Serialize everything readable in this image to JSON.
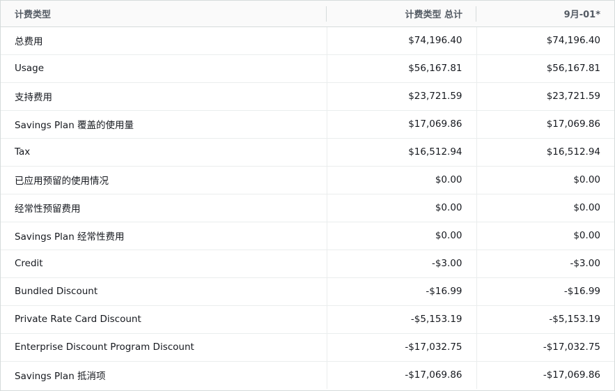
{
  "table": {
    "headers": [
      "计费类型",
      "计费类型 总计",
      "9月-01*"
    ],
    "rows": [
      {
        "type": "总费用",
        "total": "$74,196.40",
        "month": "$74,196.40"
      },
      {
        "type": "Usage",
        "total": "$56,167.81",
        "month": "$56,167.81"
      },
      {
        "type": "支持费用",
        "total": "$23,721.59",
        "month": "$23,721.59"
      },
      {
        "type": "Savings Plan 覆盖的使用量",
        "total": "$17,069.86",
        "month": "$17,069.86"
      },
      {
        "type": "Tax",
        "total": "$16,512.94",
        "month": "$16,512.94"
      },
      {
        "type": "已应用预留的使用情况",
        "total": "$0.00",
        "month": "$0.00"
      },
      {
        "type": "经常性预留费用",
        "total": "$0.00",
        "month": "$0.00"
      },
      {
        "type": "Savings Plan 经常性费用",
        "total": "$0.00",
        "month": "$0.00"
      },
      {
        "type": "Credit",
        "total": "-$3.00",
        "month": "-$3.00"
      },
      {
        "type": "Bundled Discount",
        "total": "-$16.99",
        "month": "-$16.99"
      },
      {
        "type": "Private Rate Card Discount",
        "total": "-$5,153.19",
        "month": "-$5,153.19"
      },
      {
        "type": "Enterprise Discount Program Discount",
        "total": "-$17,032.75",
        "month": "-$17,032.75"
      },
      {
        "type": "Savings Plan 抵消项",
        "total": "-$17,069.86",
        "month": "-$17,069.86"
      }
    ]
  }
}
